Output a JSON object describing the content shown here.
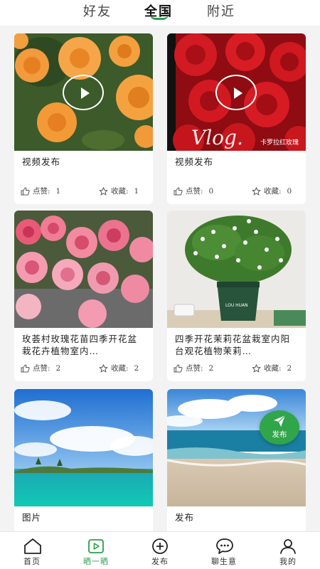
{
  "tabs": [
    {
      "label": "好友",
      "active": false
    },
    {
      "label": "全国",
      "active": true
    },
    {
      "label": "附近",
      "active": false
    }
  ],
  "cards": [
    {
      "title": "视频发布",
      "type": "video",
      "like_label": "点赞:",
      "like_count": "1",
      "fav_label": "收藏:",
      "fav_count": "1"
    },
    {
      "title": "视频发布",
      "type": "video",
      "overlay_text": "卡罗拉红玫瑰",
      "overlay_vlog": "Vlog.",
      "like_label": "点赞:",
      "like_count": "0",
      "fav_label": "收藏:",
      "fav_count": "0"
    },
    {
      "title": "玫荟村玫瑰花苗四季开花盆栽花卉植物室内…",
      "type": "image",
      "like_label": "点赞:",
      "like_count": "2",
      "fav_label": "收藏:",
      "fav_count": "2"
    },
    {
      "title": "四季开花茉莉花盆栽室内阳台观花植物茉莉…",
      "type": "image",
      "pot_text": "LOU   HUAN",
      "like_label": "点赞:",
      "like_count": "2",
      "fav_label": "收藏:",
      "fav_count": "2"
    },
    {
      "title": "图片",
      "type": "image"
    },
    {
      "title": "发布",
      "type": "image"
    }
  ],
  "fab": {
    "label": "发布",
    "icon": "send-icon",
    "color": "#30a54a"
  },
  "bottom_nav": [
    {
      "label": "首页",
      "icon": "home-icon",
      "active": false
    },
    {
      "label": "晒一晒",
      "icon": "play-square-icon",
      "active": true
    },
    {
      "label": "发布",
      "icon": "plus-circle-icon",
      "active": false
    },
    {
      "label": "聊生意",
      "icon": "chat-icon",
      "active": false
    },
    {
      "label": "我的",
      "icon": "user-icon",
      "active": false
    }
  ],
  "colors": {
    "accent": "#2e9e4a",
    "background": "#f3f3f3"
  }
}
